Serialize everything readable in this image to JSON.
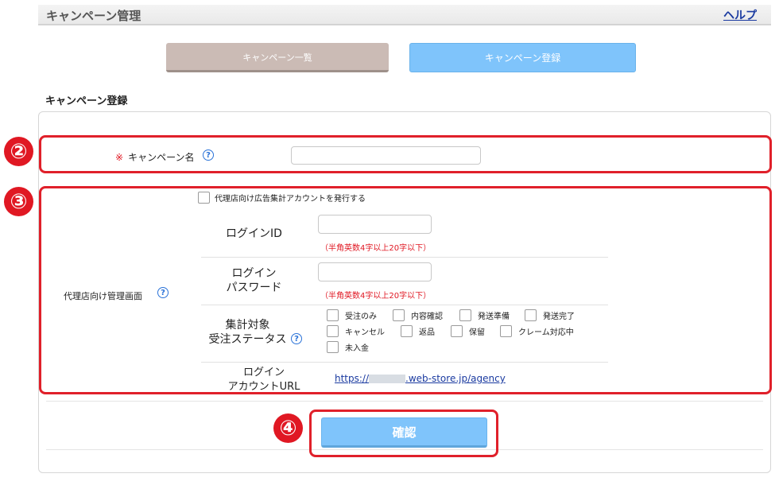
{
  "header": {
    "title": "キャンペーン管理",
    "help_link": "ヘルプ"
  },
  "tabs": [
    {
      "label": "キャンペーン一覧",
      "active": false
    },
    {
      "label": "キャンペーン登録",
      "active": true
    }
  ],
  "section_title": "キャンペーン登録",
  "callout_numbers": {
    "c2": "②",
    "c3": "③",
    "c4": "④"
  },
  "campaign": {
    "required_mark": "※",
    "label": "キャンペーン名",
    "help_glyph": "?",
    "value": ""
  },
  "agency": {
    "label": "代理店向け管理画面",
    "issue_account_label": "代理店向け広告集計アカウントを発行する",
    "login_id": {
      "label": "ログインID",
      "hint": "（半角英数4字以上20字以下）",
      "value": ""
    },
    "login_pw": {
      "label_line1": "ログイン",
      "label_line2": "パスワード",
      "hint": "（半角英数4字以上20字以下）",
      "value": ""
    },
    "status": {
      "label_line1": "集計対象",
      "label_line2": "受注ステータス",
      "options": [
        "受注のみ",
        "内容確認",
        "発送準備",
        "発送完了",
        "キャンセル",
        "返品",
        "保留",
        "クレーム対応中",
        "未入金"
      ]
    },
    "url": {
      "label_line1": "ログイン",
      "label_line2": "アカウントURL",
      "prefix": "https://",
      "suffix": ".web-store.jp/agency"
    }
  },
  "confirm_button": "確認",
  "colors": {
    "accent_blue": "#7fc4fb",
    "callout_red": "#e0202a",
    "tab_inactive": "#cbbbb5",
    "link": "#1a3aa0"
  },
  "icons": [
    "help-circle-icon",
    "checkbox-icon"
  ]
}
